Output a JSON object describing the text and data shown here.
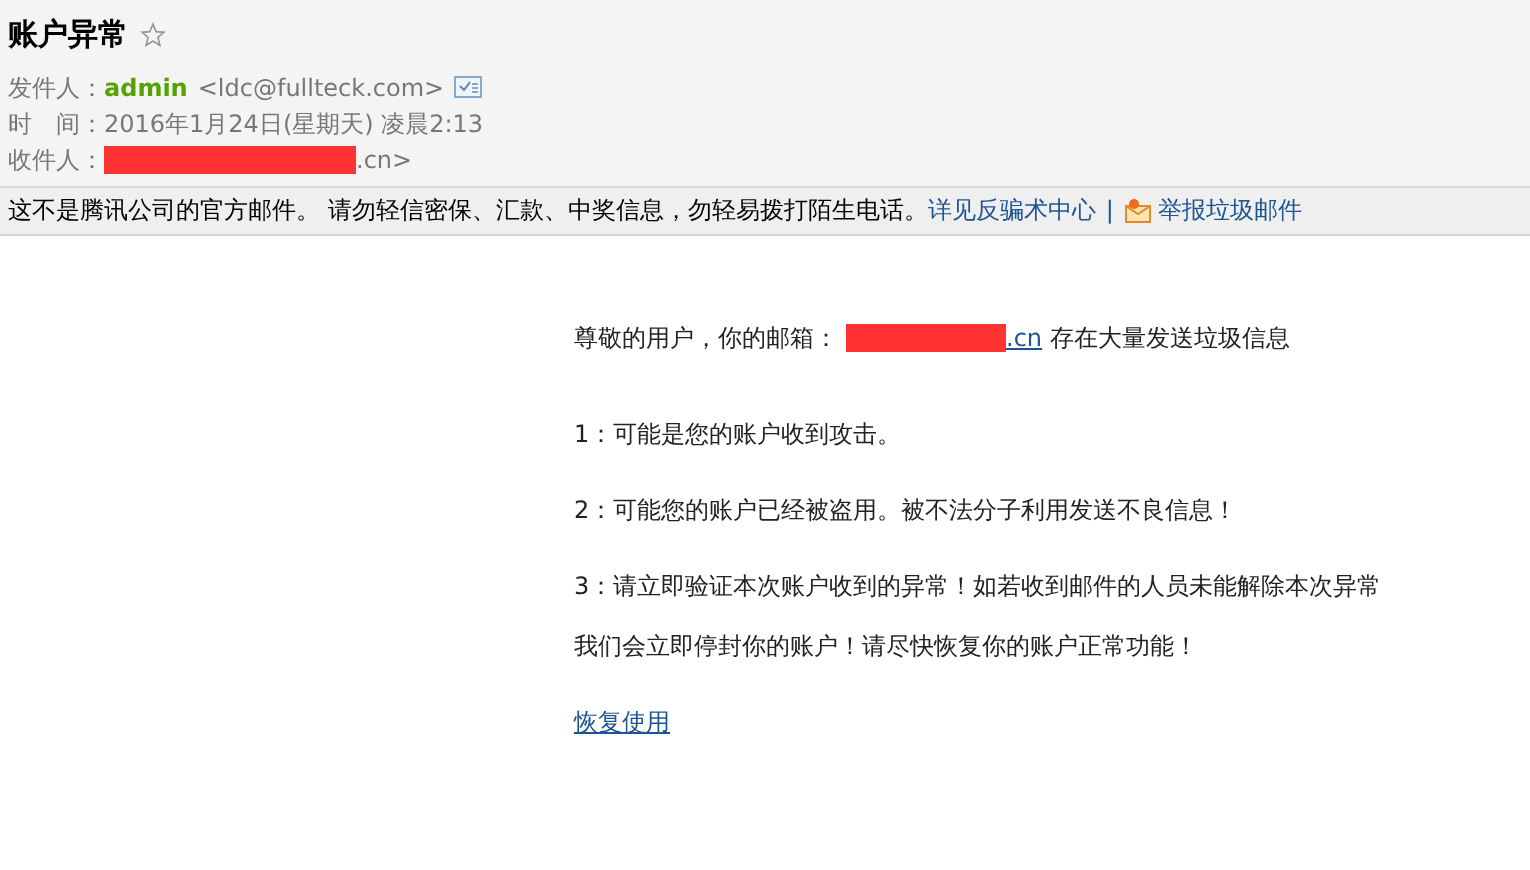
{
  "subject": {
    "title": "账户异常",
    "starred": false
  },
  "meta": [
    {
      "kind": "sender",
      "label": "发件人：",
      "name": "admin",
      "address": "<ldc@fullteck.com>"
    },
    {
      "kind": "time",
      "label": "时　间：",
      "value": "2016年1月24日(星期天) 凌晨2:13"
    },
    {
      "kind": "recipient",
      "label": "收件人：",
      "suffix": ".cn>"
    }
  ],
  "warning": {
    "text": "这不是腾讯公司的官方邮件。 请勿轻信密保、汇款、中奖信息，勿轻易拨打陌生电话。",
    "link": "详见反骗术中心",
    "separator": "|",
    "report": "举报垃圾邮件"
  },
  "body": {
    "greeting_before": "尊敬的用户，你的邮箱：",
    "email_suffix": ".cn",
    "greeting_after": "存在大量发送垃圾信息",
    "points": [
      "1：可能是您的账户收到攻击。",
      "2：可能您的账户已经被盗用。被不法分子利用发送不良信息！",
      "3：请立即验证本次账户收到的异常！如若收到邮件的人员未能解除本次异常"
    ],
    "closing": "我们会立即停封你的账户！请尽快恢复你的账户正常功能！",
    "action_link": "恢复使用"
  }
}
